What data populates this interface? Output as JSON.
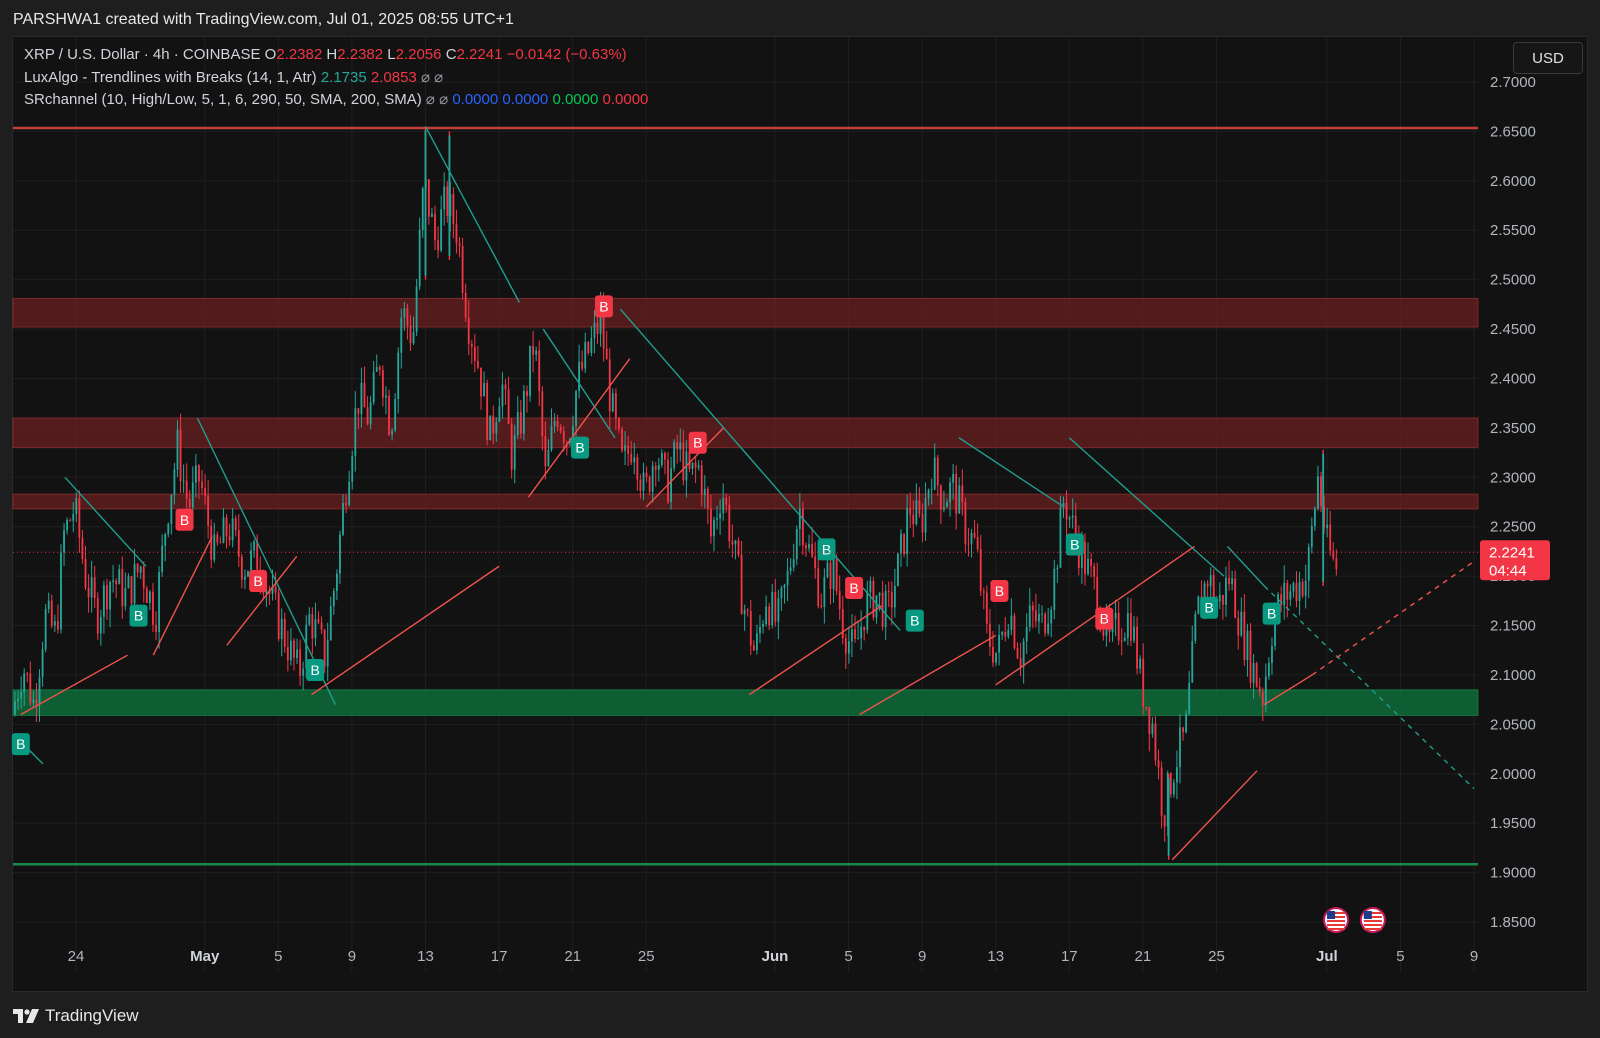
{
  "header": {
    "credit": "PARSHWA1 created with TradingView.com, Jul 01, 2025 08:55 UTC+1"
  },
  "legend": {
    "symbol": "XRP / U.S. Dollar · 4h · COINBASE",
    "o_label": "O",
    "o_value": "2.2382",
    "h_label": "H",
    "h_value": "2.2382",
    "l_label": "L",
    "l_value": "2.2056",
    "c_label": "C",
    "c_value": "2.2241",
    "change": "−0.0142 (−0.63%)",
    "indicator1_name": "LuxAlgo - Trendlines with Breaks (14, 1, Atr)",
    "indicator1_v1": "2.1735",
    "indicator1_v2": "2.0853",
    "indicator2_name": "SRchannel (10, High/Low, 5, 1, 6, 290, 50, SMA, 200, SMA)",
    "indicator2_v1": "0.0000",
    "indicator2_v2": "0.0000",
    "indicator2_v3": "0.0000",
    "indicator2_v4": "0.0000",
    "hidden_glyph": "⌀"
  },
  "currency_button": "USD",
  "price_label": {
    "value": "2.2241",
    "countdown": "04:44"
  },
  "footer": {
    "brand": "TradingView"
  },
  "colors": {
    "background": "#121212",
    "up": "#26a69a",
    "down": "#f23645",
    "resistance_zone": "#6b1f22",
    "support_zone": "#0e6b3a",
    "trend_line_down": "#1f9e8f",
    "trend_line_up": "#f0534d"
  },
  "chart_data": {
    "type": "candlestick",
    "symbol": "XRP / U.S. Dollar",
    "interval": "4h",
    "exchange": "COINBASE",
    "ylim": [
      1.82,
      2.72
    ],
    "y_ticks": [
      "2.7000",
      "2.6500",
      "2.6000",
      "2.5500",
      "2.5000",
      "2.4500",
      "2.4000",
      "2.3500",
      "2.3000",
      "2.2500",
      "2.2000",
      "2.1500",
      "2.1000",
      "2.0500",
      "2.0000",
      "1.9500",
      "1.9000",
      "1.8500"
    ],
    "x_ticks": [
      "24",
      "May",
      "5",
      "9",
      "13",
      "17",
      "21",
      "25",
      "Jun",
      "5",
      "9",
      "13",
      "17",
      "21",
      "25",
      "Jul",
      "5",
      "9"
    ],
    "x_tick_days": [
      0,
      7,
      11,
      15,
      19,
      23,
      27,
      31,
      38,
      42,
      46,
      50,
      54,
      58,
      62,
      68,
      72,
      76
    ],
    "x_range_days": [
      -3.4,
      76
    ],
    "last_day": 68,
    "current_price": 2.2241,
    "price_path": [
      [
        -3.4,
        2.06
      ],
      [
        -2.8,
        2.11
      ],
      [
        -2.2,
        2.07
      ],
      [
        -1.6,
        2.16
      ],
      [
        -1.0,
        2.14
      ],
      [
        -0.6,
        2.24
      ],
      [
        0.0,
        2.27
      ],
      [
        0.6,
        2.2
      ],
      [
        1.2,
        2.16
      ],
      [
        2.0,
        2.2
      ],
      [
        2.8,
        2.18
      ],
      [
        3.6,
        2.21
      ],
      [
        4.4,
        2.16
      ],
      [
        5.0,
        2.26
      ],
      [
        5.6,
        2.33
      ],
      [
        6.2,
        2.27
      ],
      [
        6.8,
        2.3
      ],
      [
        7.6,
        2.22
      ],
      [
        8.4,
        2.25
      ],
      [
        9.2,
        2.21
      ],
      [
        10.0,
        2.22
      ],
      [
        10.8,
        2.17
      ],
      [
        11.6,
        2.13
      ],
      [
        12.2,
        2.1
      ],
      [
        12.8,
        2.16
      ],
      [
        13.6,
        2.12
      ],
      [
        14.2,
        2.2
      ],
      [
        14.8,
        2.3
      ],
      [
        15.4,
        2.38
      ],
      [
        16.0,
        2.36
      ],
      [
        16.6,
        2.42
      ],
      [
        17.2,
        2.35
      ],
      [
        17.8,
        2.47
      ],
      [
        18.4,
        2.44
      ],
      [
        19.0,
        2.6
      ],
      [
        19.6,
        2.54
      ],
      [
        20.2,
        2.58
      ],
      [
        20.8,
        2.55
      ],
      [
        21.4,
        2.46
      ],
      [
        22.0,
        2.41
      ],
      [
        22.6,
        2.34
      ],
      [
        23.2,
        2.4
      ],
      [
        23.8,
        2.32
      ],
      [
        24.4,
        2.37
      ],
      [
        25.0,
        2.44
      ],
      [
        25.6,
        2.3
      ],
      [
        26.2,
        2.37
      ],
      [
        26.8,
        2.34
      ],
      [
        27.4,
        2.4
      ],
      [
        28.0,
        2.43
      ],
      [
        28.6,
        2.46
      ],
      [
        29.2,
        2.37
      ],
      [
        29.8,
        2.31
      ],
      [
        30.4,
        2.34
      ],
      [
        31.0,
        2.28
      ],
      [
        31.6,
        2.33
      ],
      [
        32.2,
        2.29
      ],
      [
        32.8,
        2.33
      ],
      [
        33.4,
        2.3
      ],
      [
        34.0,
        2.31
      ],
      [
        34.6,
        2.24
      ],
      [
        35.2,
        2.29
      ],
      [
        35.8,
        2.23
      ],
      [
        36.4,
        2.17
      ],
      [
        37.0,
        2.12
      ],
      [
        37.6,
        2.18
      ],
      [
        38.2,
        2.15
      ],
      [
        38.8,
        2.2
      ],
      [
        39.4,
        2.27
      ],
      [
        40.0,
        2.22
      ],
      [
        40.6,
        2.18
      ],
      [
        41.2,
        2.21
      ],
      [
        41.8,
        2.15
      ],
      [
        42.4,
        2.12
      ],
      [
        43.0,
        2.17
      ],
      [
        43.6,
        2.18
      ],
      [
        44.2,
        2.16
      ],
      [
        44.8,
        2.21
      ],
      [
        45.4,
        2.27
      ],
      [
        46.0,
        2.25
      ],
      [
        46.6,
        2.31
      ],
      [
        47.2,
        2.28
      ],
      [
        47.8,
        2.29
      ],
      [
        48.4,
        2.25
      ],
      [
        49.0,
        2.23
      ],
      [
        49.6,
        2.14
      ],
      [
        50.2,
        2.12
      ],
      [
        50.8,
        2.17
      ],
      [
        51.4,
        2.12
      ],
      [
        52.0,
        2.16
      ],
      [
        52.6,
        2.15
      ],
      [
        53.2,
        2.19
      ],
      [
        53.8,
        2.28
      ],
      [
        54.4,
        2.24
      ],
      [
        55.0,
        2.21
      ],
      [
        55.6,
        2.18
      ],
      [
        56.2,
        2.13
      ],
      [
        56.8,
        2.15
      ],
      [
        57.4,
        2.16
      ],
      [
        58.0,
        2.09
      ],
      [
        58.6,
        2.05
      ],
      [
        59.2,
        1.96
      ],
      [
        59.8,
        2.01
      ],
      [
        60.4,
        2.04
      ],
      [
        61.0,
        2.16
      ],
      [
        61.6,
        2.2
      ],
      [
        62.2,
        2.17
      ],
      [
        62.8,
        2.2
      ],
      [
        63.4,
        2.15
      ],
      [
        64.0,
        2.11
      ],
      [
        64.6,
        2.08
      ],
      [
        65.2,
        2.16
      ],
      [
        65.8,
        2.18
      ],
      [
        66.4,
        2.19
      ],
      [
        67.0,
        2.2
      ],
      [
        67.6,
        2.3
      ],
      [
        68.1,
        2.23
      ],
      [
        68.5,
        2.21
      ]
    ],
    "extreme_wicks": [
      {
        "day": 19.0,
        "high": 2.655,
        "low": 2.5
      },
      {
        "day": 20.3,
        "high": 2.65,
        "low": 2.52
      },
      {
        "day": 59.4,
        "high": 2.0,
        "low": 1.913
      },
      {
        "day": 67.8,
        "high": 2.328,
        "low": 2.19
      }
    ],
    "horizontal_lines": [
      {
        "price": 2.6535,
        "color": "#c2403c"
      },
      {
        "price": 1.9085,
        "color": "#1a8a4a"
      }
    ],
    "zones": [
      {
        "from": 2.452,
        "to": 2.481,
        "kind": "resistance"
      },
      {
        "from": 2.33,
        "to": 2.36,
        "kind": "resistance"
      },
      {
        "from": 2.268,
        "to": 2.283,
        "kind": "resistance"
      },
      {
        "from": 2.059,
        "to": 2.085,
        "kind": "support"
      }
    ],
    "trendlines_down": [
      [
        [
          -3.4,
          2.04
        ],
        [
          -1.8,
          2.01
        ]
      ],
      [
        [
          -0.6,
          2.3
        ],
        [
          3.8,
          2.21
        ]
      ],
      [
        [
          6.6,
          2.36
        ],
        [
          14.1,
          2.07
        ]
      ],
      [
        [
          19.0,
          2.655
        ],
        [
          24.1,
          2.477
        ]
      ],
      [
        [
          25.4,
          2.45
        ],
        [
          29.3,
          2.34
        ]
      ],
      [
        [
          29.6,
          2.47
        ],
        [
          44.8,
          2.145
        ]
      ],
      [
        [
          48.0,
          2.34
        ],
        [
          53.7,
          2.27
        ]
      ],
      [
        [
          54.0,
          2.34
        ],
        [
          62.4,
          2.2
        ]
      ],
      [
        [
          62.6,
          2.23
        ],
        [
          64.6,
          2.19
        ]
      ]
    ],
    "trendline_down_projection": [
      [
        64.6,
        2.19
      ],
      [
        76.0,
        1.985
      ]
    ],
    "trendlines_up": [
      [
        [
          -3.0,
          2.06
        ],
        [
          2.8,
          2.12
        ]
      ],
      [
        [
          4.2,
          2.12
        ],
        [
          7.4,
          2.24
        ]
      ],
      [
        [
          8.2,
          2.13
        ],
        [
          12.0,
          2.22
        ]
      ],
      [
        [
          12.8,
          2.08
        ],
        [
          23.0,
          2.21
        ]
      ],
      [
        [
          24.6,
          2.28
        ],
        [
          30.1,
          2.42
        ]
      ],
      [
        [
          31.0,
          2.27
        ],
        [
          35.2,
          2.35
        ]
      ],
      [
        [
          36.6,
          2.08
        ],
        [
          43.8,
          2.17
        ]
      ],
      [
        [
          42.6,
          2.06
        ],
        [
          50.0,
          2.14
        ]
      ],
      [
        [
          50.0,
          2.09
        ],
        [
          60.8,
          2.23
        ]
      ],
      [
        [
          59.6,
          1.913
        ],
        [
          64.2,
          2.003
        ]
      ],
      [
        [
          64.6,
          2.07
        ],
        [
          67.2,
          2.1
        ]
      ]
    ],
    "trendline_up_projection": [
      [
        67.2,
        2.1
      ],
      [
        76.0,
        2.215
      ]
    ],
    "signals": [
      {
        "day": -3.0,
        "price": 2.03,
        "type": "buy",
        "label": "B"
      },
      {
        "day": 3.4,
        "price": 2.16,
        "type": "buy",
        "label": "B"
      },
      {
        "day": 5.9,
        "price": 2.257,
        "type": "sell",
        "label": "B"
      },
      {
        "day": 9.9,
        "price": 2.195,
        "type": "sell",
        "label": "B"
      },
      {
        "day": 13.0,
        "price": 2.105,
        "type": "buy",
        "label": "B"
      },
      {
        "day": 27.4,
        "price": 2.33,
        "type": "buy",
        "label": "B"
      },
      {
        "day": 28.7,
        "price": 2.473,
        "type": "sell",
        "label": "B"
      },
      {
        "day": 33.8,
        "price": 2.335,
        "type": "sell",
        "label": "B"
      },
      {
        "day": 40.8,
        "price": 2.227,
        "type": "buy",
        "label": "B"
      },
      {
        "day": 42.3,
        "price": 2.188,
        "type": "sell",
        "label": "B"
      },
      {
        "day": 45.6,
        "price": 2.155,
        "type": "buy",
        "label": "B"
      },
      {
        "day": 50.2,
        "price": 2.185,
        "type": "sell",
        "label": "B"
      },
      {
        "day": 54.3,
        "price": 2.232,
        "type": "buy",
        "label": "B"
      },
      {
        "day": 55.9,
        "price": 2.157,
        "type": "sell",
        "label": "B"
      },
      {
        "day": 61.6,
        "price": 2.168,
        "type": "buy",
        "label": "B"
      },
      {
        "day": 65.0,
        "price": 2.162,
        "type": "buy",
        "label": "B"
      }
    ],
    "event_flags": [
      {
        "day": 68.5,
        "label": "US"
      },
      {
        "day": 70.5,
        "label": "US"
      }
    ]
  }
}
